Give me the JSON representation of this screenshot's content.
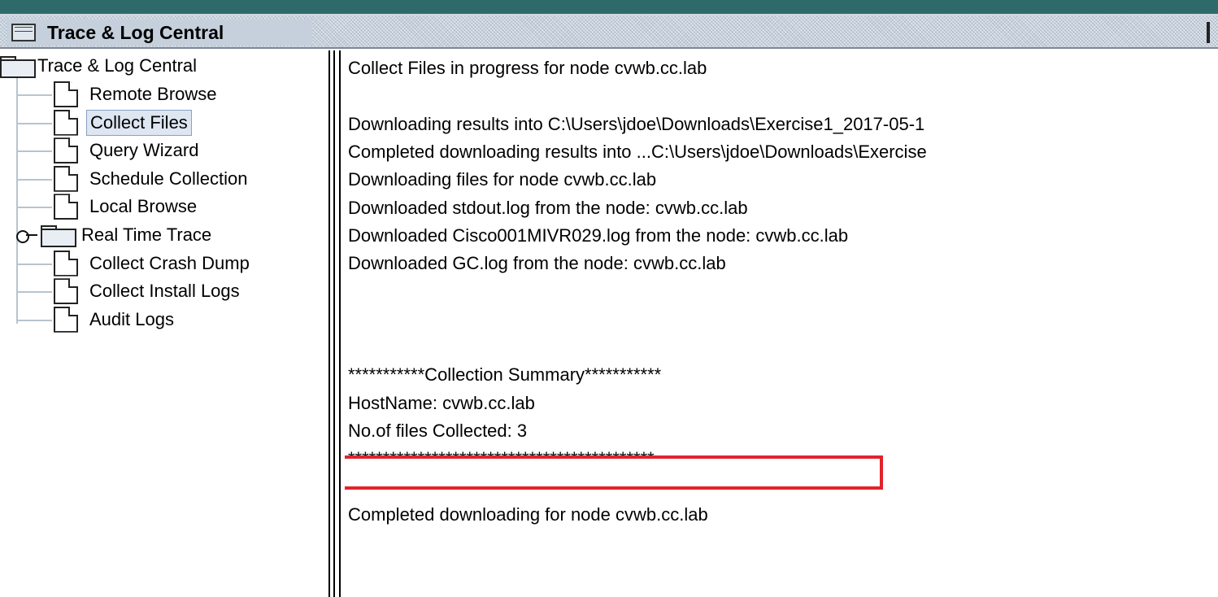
{
  "window": {
    "title": "Trace & Log Central"
  },
  "tree": {
    "root_label": "Trace & Log Central",
    "items": [
      {
        "label": "Remote Browse",
        "selected": false
      },
      {
        "label": "Collect Files",
        "selected": true
      },
      {
        "label": "Query Wizard",
        "selected": false
      },
      {
        "label": "Schedule Collection",
        "selected": false
      },
      {
        "label": "Local Browse",
        "selected": false
      },
      {
        "label": "Real Time Trace",
        "selected": false
      },
      {
        "label": "Collect Crash Dump",
        "selected": false
      },
      {
        "label": "Collect Install Logs",
        "selected": false
      },
      {
        "label": "Audit Logs",
        "selected": false
      }
    ]
  },
  "log": {
    "lines": [
      "Collect Files in progress for node cvwb.cc.lab",
      "",
      "Downloading results into C:\\Users\\jdoe\\Downloads\\Exercise1_2017-05-1",
      "Completed downloading results into ...C:\\Users\\jdoe\\Downloads\\Exercise",
      "Downloading files for node cvwb.cc.lab",
      "Downloaded stdout.log from the node: cvwb.cc.lab",
      "Downloaded Cisco001MIVR029.log from the node: cvwb.cc.lab",
      "Downloaded GC.log from the node: cvwb.cc.lab",
      "",
      "",
      "",
      "***********Collection Summary***********",
      "HostName: cvwb.cc.lab",
      "No.of files Collected: 3",
      "********************************************",
      "",
      "Completed downloading for node cvwb.cc.lab"
    ]
  },
  "colors": {
    "highlight": "#e0242c",
    "selection": "#dde6f1"
  }
}
